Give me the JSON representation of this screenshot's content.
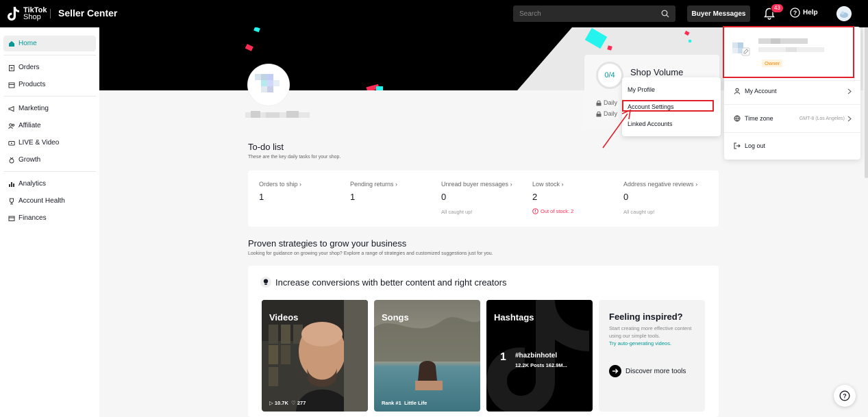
{
  "header": {
    "logo_line1": "TikTok",
    "logo_line2": "Shop",
    "title": "Seller Center",
    "search_placeholder": "Search",
    "buyer_messages": "Buyer Messages",
    "notification_count": "43",
    "help": "Help"
  },
  "sidebar": {
    "items": [
      {
        "label": "Home"
      },
      {
        "label": "Orders"
      },
      {
        "label": "Products"
      },
      {
        "label": "Marketing"
      },
      {
        "label": "Affiliate"
      },
      {
        "label": "LIVE & Video"
      },
      {
        "label": "Growth"
      },
      {
        "label": "Analytics"
      },
      {
        "label": "Account Health"
      },
      {
        "label": "Finances"
      }
    ]
  },
  "shop_volume": {
    "progress": "0/4",
    "title": "Shop Volume",
    "lock1": "Daily",
    "lock2": "Daily"
  },
  "profile_menu": {
    "items": [
      "My Profile",
      "Account Settings",
      "Linked Accounts"
    ]
  },
  "account_panel": {
    "role": "Owner",
    "my_account": "My Account",
    "time_zone": "Time zone",
    "time_zone_value": "GMT-8 (Los Angeles)",
    "log_out": "Log out"
  },
  "todo": {
    "title": "To-do list",
    "subtitle": "These are the key daily tasks for your shop.",
    "items": [
      {
        "label": "Orders to ship",
        "value": "1",
        "note": ""
      },
      {
        "label": "Pending returns",
        "value": "1",
        "note": ""
      },
      {
        "label": "Unread buyer messages",
        "value": "0",
        "note": "All caught up!"
      },
      {
        "label": "Low stock",
        "value": "2",
        "note": "Out of stock: 2"
      },
      {
        "label": "Address negative reviews",
        "value": "0",
        "note": "All caught up!"
      }
    ]
  },
  "strategies": {
    "title": "Proven strategies to grow your business",
    "subtitle": "Looking for guidance on growing your shop? Explore a range of strategies and customized suggestions just for you.",
    "card_title": "Increase conversions with better content and right creators",
    "tiles": {
      "videos": {
        "title": "Videos",
        "views": "10.7K",
        "likes": "277"
      },
      "songs": {
        "title": "Songs",
        "rank": "Rank #1",
        "name": "Little Life"
      },
      "hashtags": {
        "title": "Hashtags",
        "rank": "1",
        "tag": "#hazbinhotel",
        "stats": "12.2K Posts  162.9M..."
      },
      "inspired": {
        "title": "Feeling inspired?",
        "text": "Start creating more effective content using our simple tools.",
        "link": "Try auto-generating videos.",
        "button": "Discover more tools"
      }
    }
  },
  "colors": {
    "accent": "#009995",
    "danger": "#fe2c55",
    "highlight": "#e0202a"
  }
}
